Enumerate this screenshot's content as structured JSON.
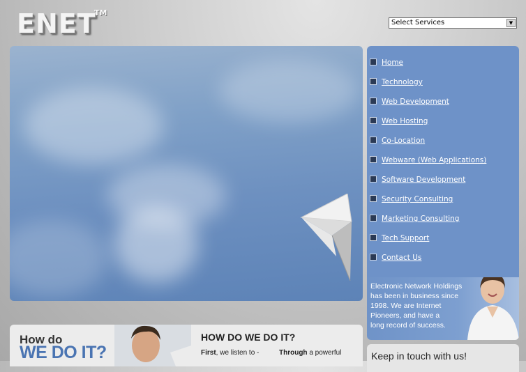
{
  "brand": {
    "logo": "ENET",
    "trademark": "TM"
  },
  "services_select": {
    "selected": "Select Services"
  },
  "nav": {
    "items": [
      "Home",
      "Technology",
      "Web Development",
      "Web Hosting",
      "Co-Location",
      "Webware (Web Applications)",
      "Software Development",
      "Security Consulting",
      "Marketing Consulting",
      "Tech Support",
      "Contact Us"
    ]
  },
  "promo": {
    "line1": "Electronic Network Holdings",
    "line2": "has been in business since",
    "line3": "1998. We are Internet",
    "line4": "Pioneers, and have a",
    "line5": "long record of success."
  },
  "how": {
    "small": "How do",
    "big": "WE DO IT?",
    "heading": "HOW DO WE DO IT?",
    "first_bold": "First",
    "first_rest": ", we listen to -",
    "through_bold": "Through",
    "through_rest": " a powerful"
  },
  "keep_in_touch": {
    "title": "Keep in touch with us!"
  },
  "icons": {
    "nav_bullet": "arrow-bullet-icon",
    "select_arrow": "chevron-down-icon"
  },
  "colors": {
    "nav_panel": "#6e92c8",
    "accent_blue": "#4a74b2",
    "link_text": "#ffffff"
  }
}
